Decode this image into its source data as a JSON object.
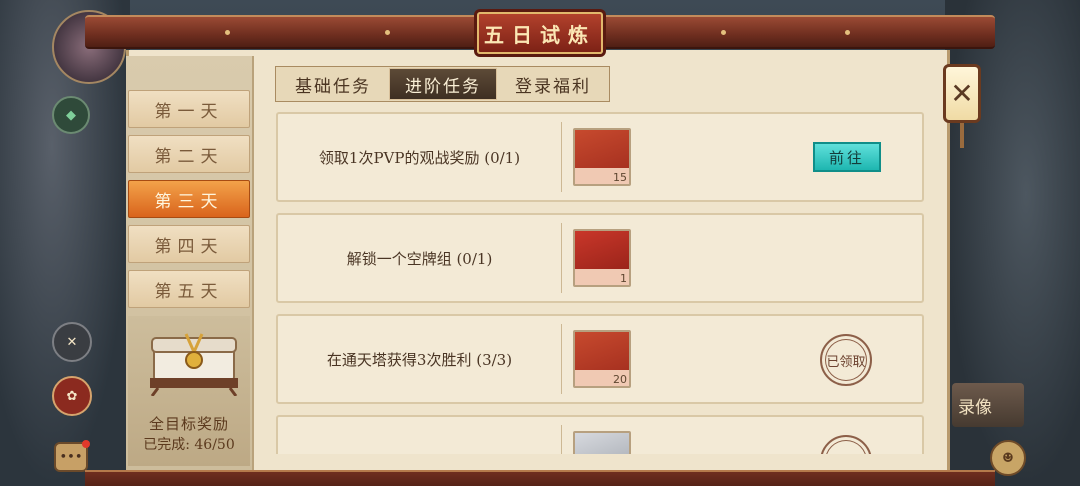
{
  "title": "五日试炼",
  "task_tabs": [
    {
      "label": "基础任务",
      "active": false
    },
    {
      "label": "进阶任务",
      "active": true
    },
    {
      "label": "登录福利",
      "active": false
    }
  ],
  "days": [
    {
      "label": "第一天",
      "active": false
    },
    {
      "label": "第二天",
      "active": false
    },
    {
      "label": "第三天",
      "active": true
    },
    {
      "label": "第四天",
      "active": false
    },
    {
      "label": "第五天",
      "active": false
    }
  ],
  "chest": {
    "label": "全目标奖励",
    "progress": "已完成: 46/50"
  },
  "tasks": [
    {
      "name": "领取1次PVP的观战奖励 (0/1)",
      "reward_count": "15",
      "action": "前往",
      "state": "go"
    },
    {
      "name": "解锁一个空牌组 (0/1)",
      "reward_count": "1",
      "action": "",
      "state": "none"
    },
    {
      "name": "在通天塔获得3次胜利 (3/3)",
      "reward_count": "20",
      "action": "已领取",
      "state": "claimed"
    },
    {
      "name": "",
      "reward_count": "",
      "action": "",
      "state": "claimed"
    }
  ],
  "side": {
    "replay_label": "录像"
  },
  "icons": {
    "close": "close-icon",
    "chest": "treasure-chest-icon",
    "chat": "chat-icon"
  },
  "colors": {
    "accent_orange": "#d9641c",
    "go_button": "#1eb6b0",
    "title_red": "#b2412c"
  }
}
